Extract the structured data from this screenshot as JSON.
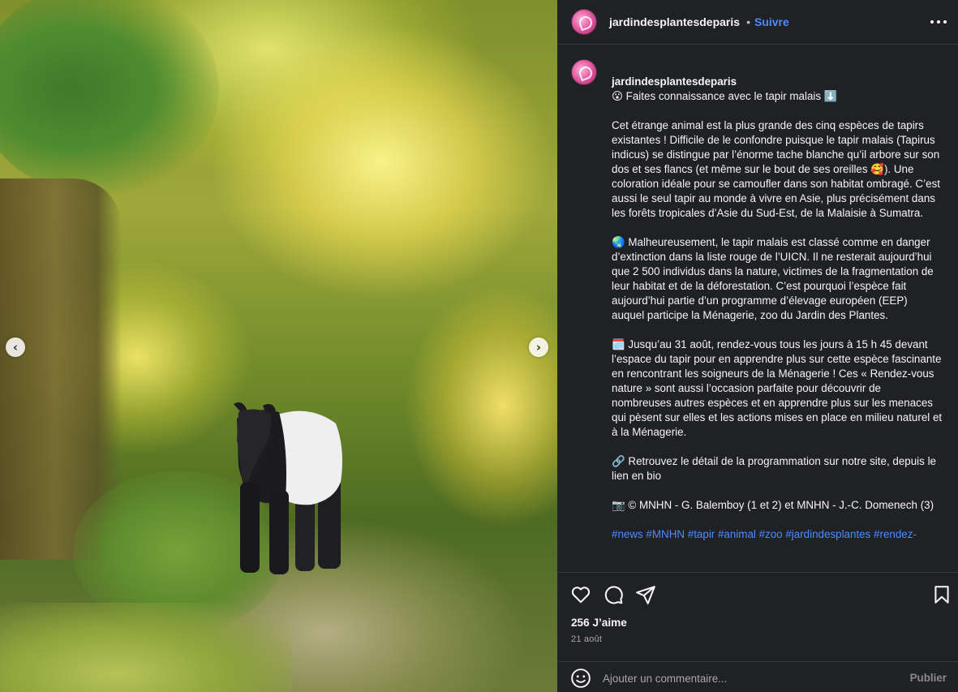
{
  "colors": {
    "panel_bg": "#202125",
    "link_blue": "#4c8dff",
    "text_primary": "#f5f5f5",
    "text_secondary": "#a8a8a8"
  },
  "media": {
    "description_icons": {
      "prev": "chevron-left-icon",
      "next": "chevron-right-icon"
    },
    "prev_glyph": "‹",
    "next_glyph": "›"
  },
  "header": {
    "username": "jardindesplantesdeparis",
    "separator": "•",
    "follow_label": "Suivre",
    "more_icon": "more-horizontal-icon"
  },
  "caption": {
    "username": "jardindesplantesdeparis",
    "intro": "😮 Faites connaissance avec le tapir malais ⬇️",
    "paragraphs": [
      "Cet étrange animal est la plus grande des cinq espèces de tapirs existantes ! Difficile de le confondre puisque le tapir malais (Tapirus indicus) se distingue par l’énorme tache blanche qu’il arbore sur son dos et ses flancs (et même sur le bout de ses oreilles 🥰). Une coloration idéale pour se camoufler dans son habitat ombragé. C’est aussi le seul tapir au monde à vivre en Asie, plus précisément dans les forêts tropicales d’Asie du Sud-Est, de la Malaisie à Sumatra.",
      "🌏 Malheureusement, le tapir malais est classé comme en danger d’extinction dans la liste rouge de l’UICN. Il ne resterait aujourd’hui que 2 500 individus dans la nature, victimes de la fragmentation de leur habitat et de la déforestation. C’est pourquoi l’espèce fait aujourd’hui partie d’un programme d’élevage européen (EEP) auquel participe la Ménagerie, zoo du Jardin des Plantes.",
      "🗓️ Jusqu’au 31 août, rendez-vous tous les jours à 15 h 45 devant l’espace du tapir pour en apprendre plus sur cette espèce fascinante en rencontrant les soigneurs de la Ménagerie ! Ces « Rendez-vous nature » sont aussi l’occasion parfaite pour découvrir de nombreuses autres espèces et en apprendre plus sur les menaces qui pèsent sur elles et les actions mises en place en milieu naturel et à la Ménagerie.",
      "🔗 Retrouvez le détail de la programmation sur notre site, depuis le lien en bio",
      "📷 © MNHN - G. Balemboy (1 et 2) et MNHN - J.-C. Domenech (3)"
    ],
    "hashtags": "#news #MNHN #tapir #animal #zoo #jardindesplantes #rendez-"
  },
  "actions": {
    "like_icon": "heart-icon",
    "comment_icon": "comment-icon",
    "share_icon": "send-icon",
    "save_icon": "bookmark-icon",
    "likes_text": "256 J’aime",
    "date_text": "21 août"
  },
  "comment": {
    "emoji_icon": "emoji-icon",
    "placeholder": "Ajouter un commentaire...",
    "publish_label": "Publier"
  }
}
